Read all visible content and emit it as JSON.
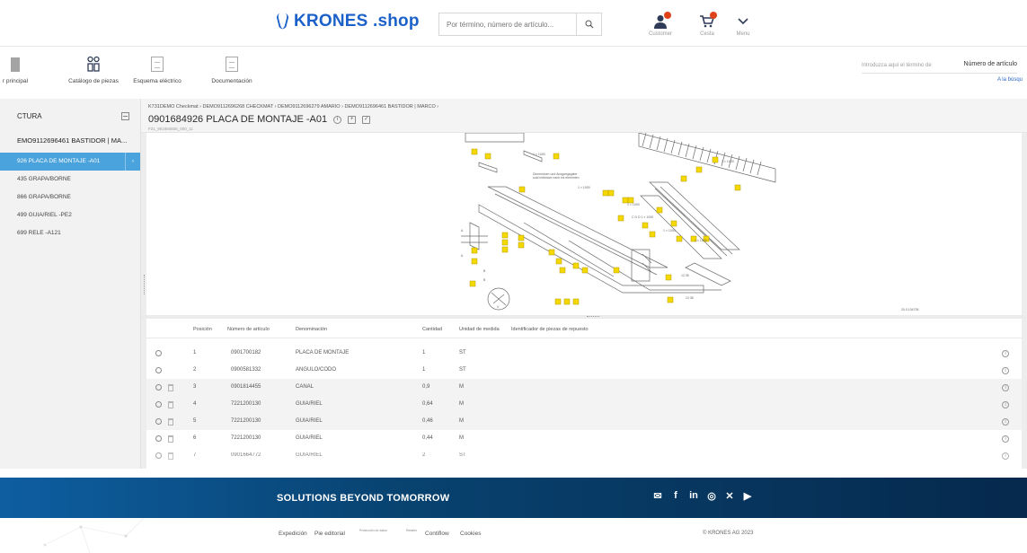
{
  "header": {
    "logo_text": "KRONES .shop",
    "search_placeholder": "Por término, número de artículo...",
    "icons": [
      {
        "name": "customer",
        "label": "Customer"
      },
      {
        "name": "cart",
        "label": "Cesta"
      },
      {
        "name": "menu",
        "label": "Menu"
      }
    ],
    "accent_color": "#1b61c9",
    "badge_color": "#e0421b"
  },
  "toolbar": {
    "items": [
      {
        "label": "r principal"
      },
      {
        "label": "Catálogo de piezas"
      },
      {
        "label": "Esquema eléctrico"
      },
      {
        "label": "Documentación"
      }
    ],
    "search_placeholder": "Introduzca aquí el término de",
    "search_type": "Número de artículo",
    "advanced_link": "A la búsqu"
  },
  "sidebar": {
    "title": "CTURA",
    "root": "EMO9112696461 BASTIDOR | MA...",
    "items": [
      {
        "label": "926 PLACA DE MONTAJE -A01",
        "active": true
      },
      {
        "label": "435 GRAPA/BORNE"
      },
      {
        "label": "866 GRAPA/BORNE"
      },
      {
        "label": "499 GUIA/RIEL -PE2"
      },
      {
        "label": "699 RELE -A121"
      }
    ]
  },
  "content": {
    "breadcrumb": "K731DEMO Checkmat  ›  DEMO9112696268 CHECKMAT  ›  DEMO9112696279 AMARIO  ›  DEMO9112696461 BASTIDOR | MARCO  ›",
    "title": "0901684926 PLACA DE MONTAJE -A01",
    "subcode": "F21_901684926_000_11"
  },
  "table": {
    "headers": {
      "position": "Posición",
      "article": "Número de artículo",
      "name": "Denominación",
      "qty": "Cantidad",
      "unit": "Unidad de medida",
      "spare": "Identificador de piezas de repuesto"
    },
    "rows": [
      {
        "pos": "1",
        "article": "0901700182",
        "name": "PLACA DE MONTAJE",
        "qty": "1",
        "unit": "ST",
        "bin": false
      },
      {
        "pos": "2",
        "article": "0900581332",
        "name": "ANGULO/CODO",
        "qty": "1",
        "unit": "ST",
        "bin": false
      },
      {
        "pos": "3",
        "article": "0901814455",
        "name": "CANAL",
        "qty": "0,9",
        "unit": "M",
        "bin": true
      },
      {
        "pos": "4",
        "article": "7221200130",
        "name": "GUIA/RIEL",
        "qty": "0,64",
        "unit": "M",
        "bin": true
      },
      {
        "pos": "5",
        "article": "7221200130",
        "name": "GUIA/RIEL",
        "qty": "0,46",
        "unit": "M",
        "bin": true
      },
      {
        "pos": "6",
        "article": "7221200130",
        "name": "GUIA/RIEL",
        "qty": "0,44",
        "unit": "M",
        "bin": true
      },
      {
        "pos": "7",
        "article": "0901664772",
        "name": "GUIA/RIEL",
        "qty": "2",
        "unit": "ST",
        "bin": true
      }
    ]
  },
  "footer": {
    "slogan": "SOLUTIONS BEYOND TOMORROW",
    "social_icons": [
      "mail-icon",
      "facebook-icon",
      "linkedin-icon",
      "instagram-icon",
      "krones-icon",
      "youtube-icon"
    ],
    "links": [
      "Expedición",
      "Pie editorial",
      "Protección de datos",
      "Retailer",
      "Contiflow",
      "Cookies"
    ],
    "copyright": "© KRONES AG 2023"
  }
}
